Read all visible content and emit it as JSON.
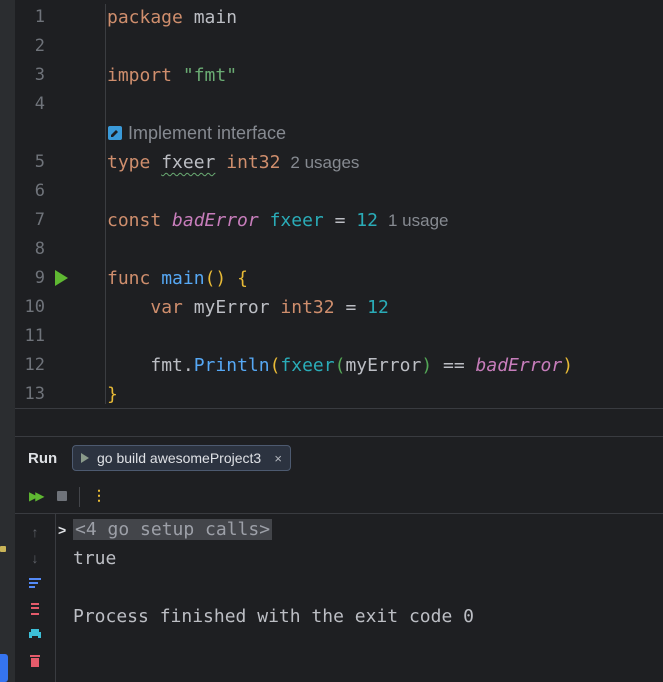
{
  "editor": {
    "inlay_hint": "Implement interface",
    "usages_type": "2 usages",
    "usages_const": "1 usage",
    "lines": [
      {
        "n": "1"
      },
      {
        "n": "2"
      },
      {
        "n": "3"
      },
      {
        "n": "4"
      },
      {
        "n": "5"
      },
      {
        "n": "6"
      },
      {
        "n": "7"
      },
      {
        "n": "8"
      },
      {
        "n": "9"
      },
      {
        "n": "10"
      },
      {
        "n": "11"
      },
      {
        "n": "12"
      },
      {
        "n": "13"
      }
    ],
    "code": {
      "l1_kw": "package",
      "l1_id": "main",
      "l3_kw": "import",
      "l3_str": "\"fmt\"",
      "l5_kw": "type",
      "l5_id": "fxeer",
      "l5_ty": "int32",
      "l7_kw": "const",
      "l7_id": "badError",
      "l7_ty": "fxeer",
      "l7_eq": "=",
      "l7_num": "12",
      "l9_kw": "func",
      "l9_fn": "main",
      "l9_paren": "()",
      "l9_brace": "{",
      "l10_kw": "var",
      "l10_id": "myError",
      "l10_ty": "int32",
      "l10_eq": "=",
      "l10_num": "12",
      "l12_pkg": "fmt",
      "l12_dot": ".",
      "l12_fn": "Println",
      "l12_p1": "(",
      "l12_conv": "fxeer",
      "l12_p2": "(",
      "l12_arg": "myError",
      "l12_p3": ")",
      "l12_op": "==",
      "l12_const": "badError",
      "l12_p4": ")",
      "l13_brace": "}"
    }
  },
  "run": {
    "title": "Run",
    "tab_label": "go build awesomeProject3",
    "tab_close": "×",
    "console": {
      "folded": "<4 go setup calls>",
      "output": "true",
      "exit": "Process finished with the exit code 0"
    }
  },
  "icons": {
    "rerun": "rerun-icon",
    "stop": "stop-icon",
    "more": "more-vertical-icon"
  }
}
